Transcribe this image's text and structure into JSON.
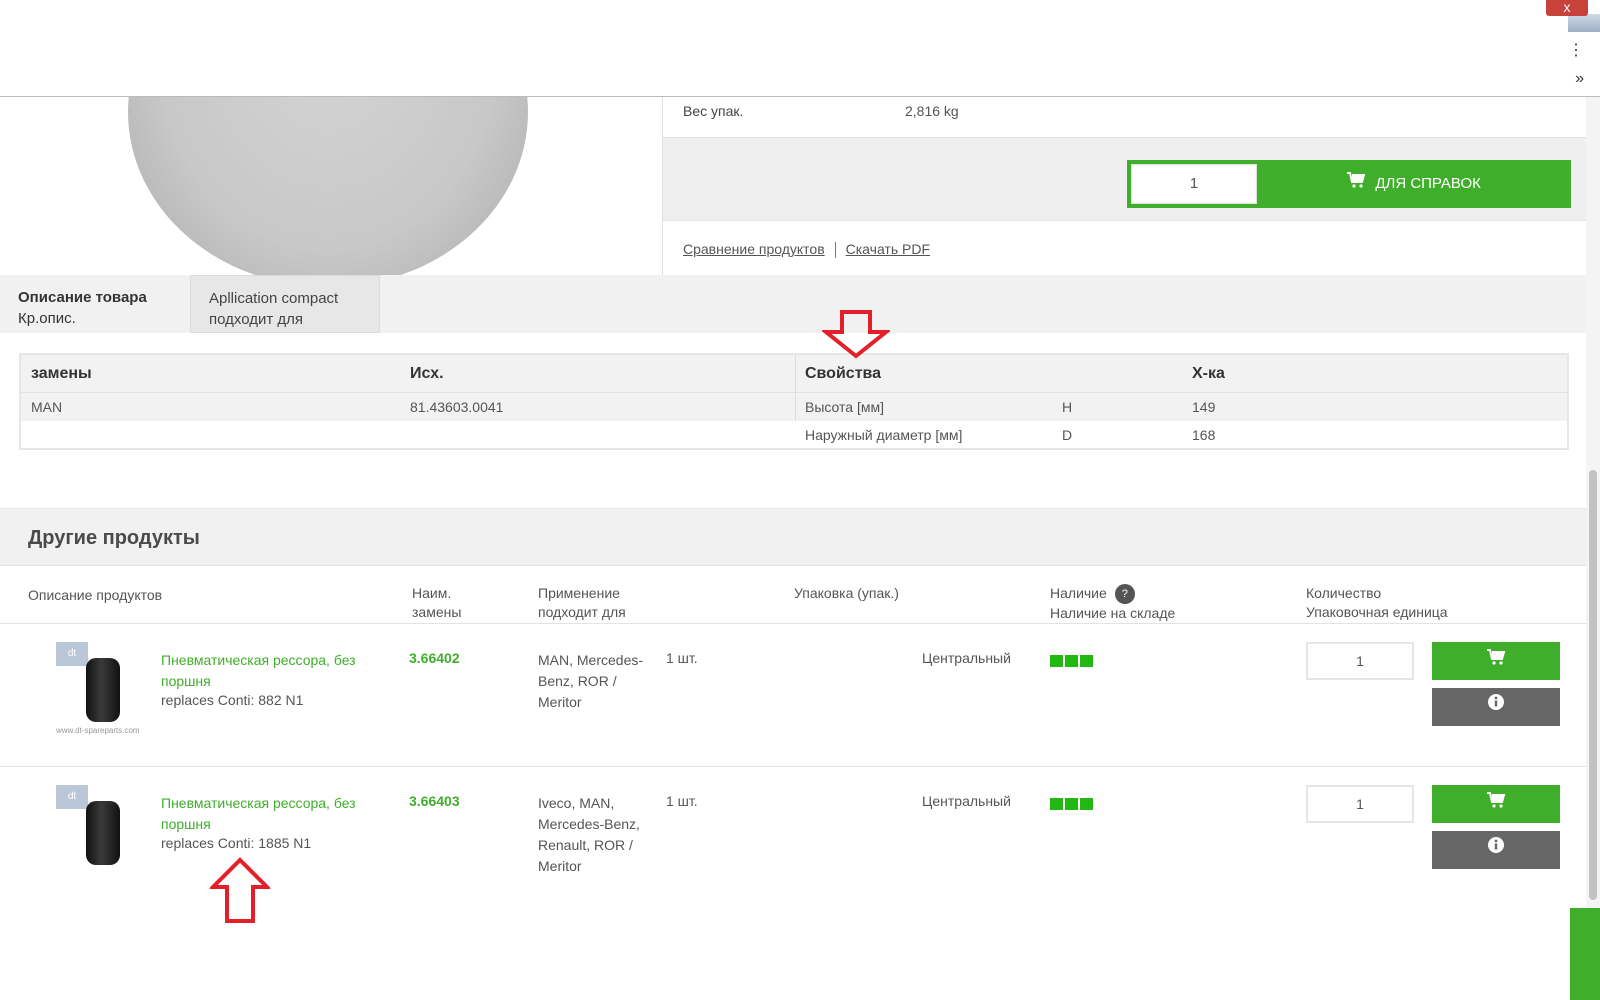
{
  "browser": {
    "close_glyph": "x",
    "menu_glyph": "⋮",
    "more_glyph": "»"
  },
  "product": {
    "weight_label": "Вес упак.",
    "weight_value": "2,816 kg",
    "quantity": "1",
    "cart_button_label": "ДЛЯ СПРАВОК",
    "compare_link": "Сравнение продуктов",
    "pdf_link": "Скачать PDF"
  },
  "tabs": [
    {
      "title": "Описание товара",
      "subtitle": "Кр.опис."
    },
    {
      "title": "Apllication compact",
      "subtitle": "подходит для"
    }
  ],
  "spec_table": {
    "headers": {
      "replacements": "замены",
      "original": "Исх.",
      "properties": "Свойства",
      "characteristics": "Х-ка"
    },
    "replacement_row": {
      "brand": "MAN",
      "number": "81.43603.0041"
    },
    "properties": [
      {
        "name": "Высота [мм]",
        "code": "H",
        "value": "149"
      },
      {
        "name": "Наружный диаметр [мм]",
        "code": "D",
        "value": "168"
      }
    ]
  },
  "other_products": {
    "heading": "Другие продукты",
    "columns": {
      "description": "Описание продуктов",
      "number_line1": "Наим.",
      "number_line2": "замены",
      "application_line1": "Применение",
      "application_line2": "подходит для",
      "packaging": "Упаковка (упак.)",
      "availability_line1": "Наличие",
      "availability_help": "?",
      "availability_line2": "Наличие на складе",
      "quantity_line1": "Количество",
      "quantity_line2": "Упаковочная единица"
    },
    "items": [
      {
        "title": "Пневматическая рессора, без поршня",
        "replaces": "replaces Conti: 882 N1",
        "number": "3.66402",
        "application": "MAN, Mercedes-Benz, ROR / Meritor",
        "packaging": "1 шт.",
        "warehouse": "Центральный",
        "stock_level": 3,
        "quantity": "1",
        "watermark": "www.dt-spareparts.com"
      },
      {
        "title": "Пневматическая рессора, без поршня",
        "replaces": "replaces Conti: 1885 N1",
        "number": "3.66403",
        "application": "Iveco, MAN, Mercedes-Benz, Renault, ROR / Meritor",
        "packaging": "1 шт.",
        "warehouse": "Центральный",
        "stock_level": 3,
        "quantity": "1"
      }
    ]
  },
  "colors": {
    "accent_green": "#3fae2a",
    "stock_green": "#22b814",
    "annotation_red": "#e3202a"
  }
}
